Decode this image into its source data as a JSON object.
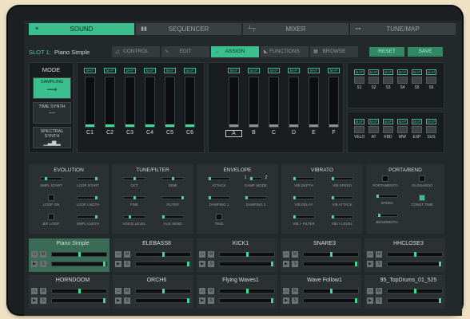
{
  "tabs": [
    {
      "label": "SOUND",
      "icon": "sound-icon",
      "active": true
    },
    {
      "label": "SEQUENCER",
      "icon": "bars-icon",
      "active": false
    },
    {
      "label": "MIXER",
      "icon": "mixer-icon",
      "active": false
    },
    {
      "label": "TUNE/MAP",
      "icon": "tune-icon",
      "active": false
    }
  ],
  "slot": {
    "label": "SLOT 1:",
    "name": "Piano Simple"
  },
  "subtabs": [
    {
      "label": "CONTROL",
      "icon": "tri-icon"
    },
    {
      "label": "EDIT",
      "icon": "wave-icon"
    },
    {
      "label": "ASSIGN",
      "icon": "arrow-icon"
    },
    {
      "label": "FUNCTIONS",
      "icon": "func-icon"
    },
    {
      "label": "BROWSE",
      "icon": "grid-icon"
    }
  ],
  "actions": {
    "reset": "RESET",
    "save": "SAVE"
  },
  "mode": {
    "title": "MODE",
    "buttons": [
      {
        "label": "SAMPLING",
        "active": true
      },
      {
        "label": "TIME SYNTH",
        "active": false
      },
      {
        "label": "SPECTRAL SYNTH",
        "active": false
      }
    ]
  },
  "map_label": "MAP",
  "faders_left": [
    {
      "label": "C1",
      "level": 0.0
    },
    {
      "label": "C2",
      "level": 0.0
    },
    {
      "label": "C3",
      "level": 0.0
    },
    {
      "label": "C4",
      "level": 0.0
    },
    {
      "label": "C5",
      "level": 0.0
    },
    {
      "label": "C6",
      "level": 0.0
    }
  ],
  "faders_right": [
    {
      "label": "A",
      "level": 0.0,
      "selected": true
    },
    {
      "label": "B",
      "level": 0.0
    },
    {
      "label": "C",
      "level": 0.0
    },
    {
      "label": "D",
      "level": 0.0
    },
    {
      "label": "E",
      "level": 0.0
    },
    {
      "label": "F",
      "level": 0.0
    }
  ],
  "sends": [
    "S1",
    "S2",
    "S3",
    "S4",
    "S5",
    "S6"
  ],
  "controllers": [
    "VELO",
    "AT",
    "KBD",
    "MW",
    "EXP",
    "SUS"
  ],
  "modules": {
    "evolution": {
      "title": "EVOLUTION",
      "smpl_start": "SMPL START",
      "loop_start": "LOOP START",
      "loop_on": "LOOP ON",
      "loop_length": "LOOP LNGTH",
      "bf_loop": "B/F LOOP",
      "smpl_length": "SMPL LNGTH"
    },
    "tune": {
      "title": "TUNE/FILTER",
      "oct": "OCT",
      "semi": "SEMI",
      "fine": "FINE",
      "filter": "FILTER",
      "voice_level": "VOICE LEVEL",
      "aux_send": "AUX SEND"
    },
    "envelope": {
      "title": "ENVELOPE",
      "attack": "ATTACK",
      "damp_mode": "DAMP MODE",
      "damp1_num": "1",
      "damp2_num": "2",
      "damping1": "DAMPING 1",
      "damping2": "DAMPING 2",
      "trig": "TRIG"
    },
    "vibrato": {
      "title": "VIBRATO",
      "vib_depth": "VIB DEPTH",
      "vib_speed": "VIB SPEED",
      "vib_delay": "VIB DELAY",
      "vib_attack": "VIB ATTACK",
      "vib_filter": "VIB > FILTER",
      "vib_level": "VIB > LEVEL"
    },
    "porta": {
      "title": "PORTA/BEND",
      "portamento": "PORTAMENTO",
      "glissando": "GLISSANDO",
      "speed": "SPEED",
      "const_time": "CONST TIME",
      "bendwidth": "BENDWIDTH"
    }
  },
  "slots": [
    {
      "name": "Piano Simple",
      "active": true
    },
    {
      "name": "ELEBASS8",
      "active": false
    },
    {
      "name": "KICK1",
      "active": false
    },
    {
      "name": "SNARE3",
      "active": false
    },
    {
      "name": "HHCLOSE3",
      "active": false
    },
    {
      "name": "HORNDOOM",
      "active": false
    },
    {
      "name": "ORCH6",
      "active": false
    },
    {
      "name": "Flying Waves1",
      "active": false
    },
    {
      "name": "Wave Follow1",
      "active": false
    },
    {
      "name": "95_TopDrums_01_525",
      "active": false
    }
  ],
  "slot_buttons": {
    "m": "M",
    "s": "S"
  },
  "colors": {
    "accent": "#3bbf8e",
    "bg": "#23282b",
    "frame": "#efe1c4"
  }
}
